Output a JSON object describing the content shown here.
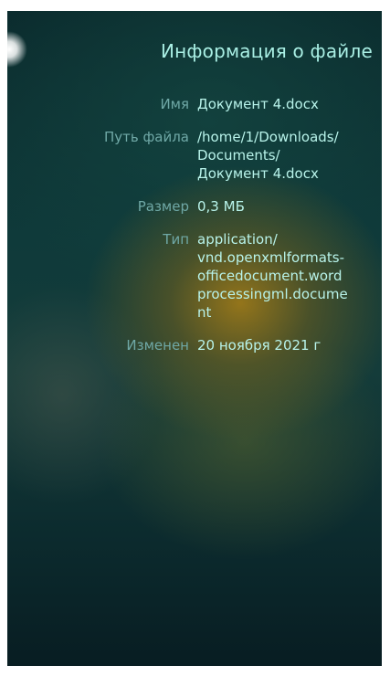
{
  "header": {
    "title": "Информация о файле"
  },
  "details": [
    {
      "label": "Имя",
      "value": "Документ 4.docx"
    },
    {
      "label": "Путь файла",
      "value": "/home/1/Downloads/\nDocuments/\nДокумент 4.docx"
    },
    {
      "label": "Размер",
      "value": "0,3 МБ"
    },
    {
      "label": "Тип",
      "value": "application/\nvnd.openxmlformats-\nofficedocument.word\nprocessingml.docume\nnt"
    },
    {
      "label": "Изменен",
      "value": "20 ноября 2021 г"
    }
  ],
  "colors": {
    "title": "#a9efe4",
    "label": "#6fa8a6",
    "value": "#b8f3ea",
    "background": "#0f3a3a"
  }
}
